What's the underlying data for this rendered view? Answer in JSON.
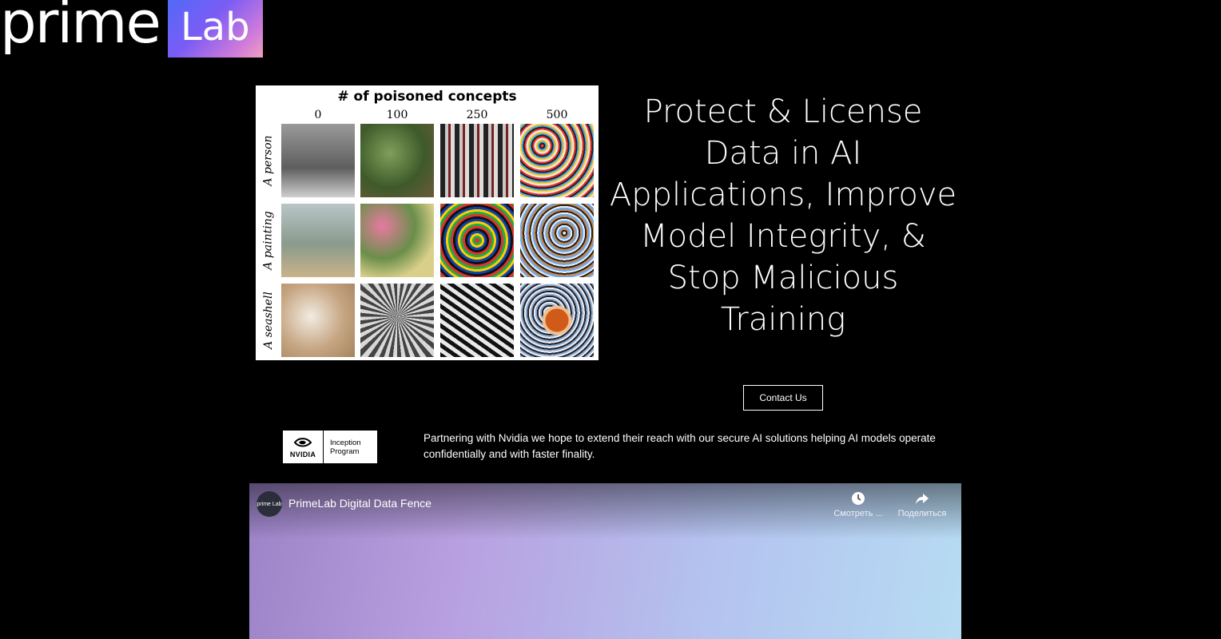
{
  "logo": {
    "prime": "prime",
    "lab": "Lab"
  },
  "figure": {
    "title": "# of poisoned concepts",
    "columns": [
      "0",
      "100",
      "250",
      "500"
    ],
    "rows": [
      "A person",
      "A painting",
      "A seashell"
    ]
  },
  "hero": {
    "headline": "Protect & License Data in AI Applications, Improve Model Integrity, & Stop Malicious Training",
    "contact_label": "Contact Us"
  },
  "partner": {
    "badge_word": "NVIDIA",
    "badge_line1": "Inception",
    "badge_line2": "Program",
    "text": "Partnering with Nvidia we hope to extend their reach with our secure AI solutions helping AI models operate confidentially and with faster finality."
  },
  "video": {
    "channel_label": "prime Lab",
    "title": "PrimeLab Digital Data Fence",
    "watch_later": "Смотреть ...",
    "share": "Поделиться"
  }
}
